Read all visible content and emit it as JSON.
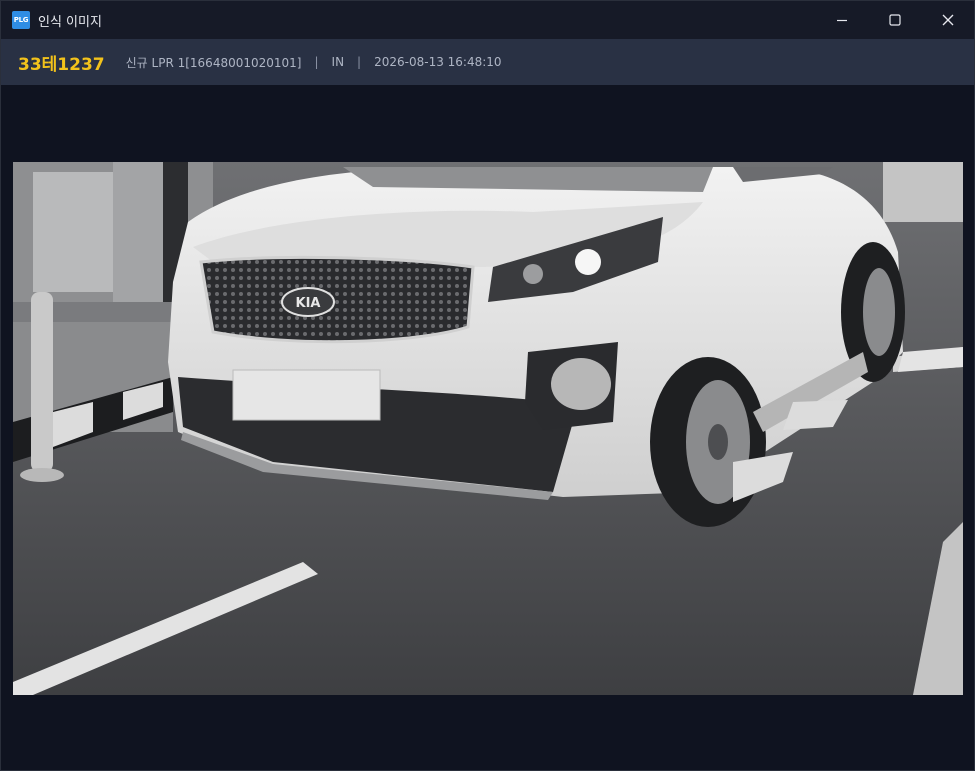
{
  "window": {
    "icon_text": "PLG",
    "title": "인식 이미지"
  },
  "controls": {
    "minimize_icon": "minimize-icon",
    "maximize_icon": "maximize-icon",
    "close_icon": "close-icon"
  },
  "info": {
    "plate": "33테1237",
    "device": "신규 LPR 1[16648001020101]",
    "separator": "|",
    "direction": "IN",
    "timestamp": "2026-08-13 16:48:10"
  },
  "colors": {
    "plate_text": "#f2c21b",
    "infobar_bg": "#293144",
    "titlebar_bg": "#161a27",
    "window_bg": "#0f1320"
  }
}
